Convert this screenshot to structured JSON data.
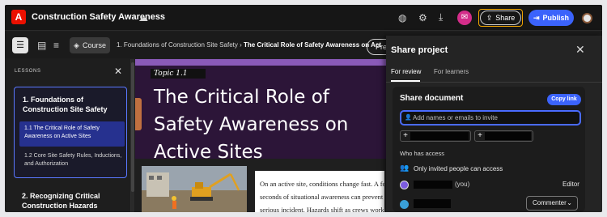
{
  "app": {
    "title": "Construction Safety Awareness",
    "logo_glyph": "A",
    "brand_color": "#eb1000"
  },
  "toolbar": {
    "icons": [
      "cloud-icon",
      "palette-icon",
      "settings-icon",
      "download-icon",
      "notification-icon"
    ],
    "share_label": "Share",
    "publish_label": "Publish",
    "accent": "#3b63fb",
    "highlight": "#f0a400"
  },
  "nav": {
    "course_label": "Course",
    "breadcrumb_parent": "1. Foundations of Construction Site Safety",
    "breadcrumb_sep": "›",
    "breadcrumb_current": "The Critical Role of Safety Awareness on Act",
    "prev_label": "Pre"
  },
  "lessons": {
    "header": "LESSONS",
    "items": [
      {
        "title": "1. Foundations of Construction Site Safety",
        "subitems": [
          "1.1 The Critical Role of Safety Awareness on Active Sites",
          "1.2 Core Site Safety Rules, Inductions, and Authorization"
        ]
      },
      {
        "title": "2. Recognizing Critical Construction Hazards"
      }
    ]
  },
  "content": {
    "topic": "Topic 1.1",
    "title": "The Critical Role of Safety Awareness on Active Sites",
    "body_lines": [
      "On an active site, conditions change fast. A few",
      "seconds of situational awareness can prevent a",
      "serious incident. Hazards shift as crews work"
    ]
  },
  "share_panel": {
    "title": "Share project",
    "tabs": [
      {
        "label": "For review",
        "active": true
      },
      {
        "label": "For learners",
        "active": false
      }
    ],
    "document_heading": "Share document",
    "copy_link_label": "Copy link",
    "invite_placeholder": "Add names or emails to invite",
    "who_has_access": "Who has access",
    "anyone_text": "Only invited people can access",
    "users": [
      {
        "you_label": "(you)",
        "role": "Editor"
      },
      {
        "role": "Commenter"
      }
    ]
  }
}
